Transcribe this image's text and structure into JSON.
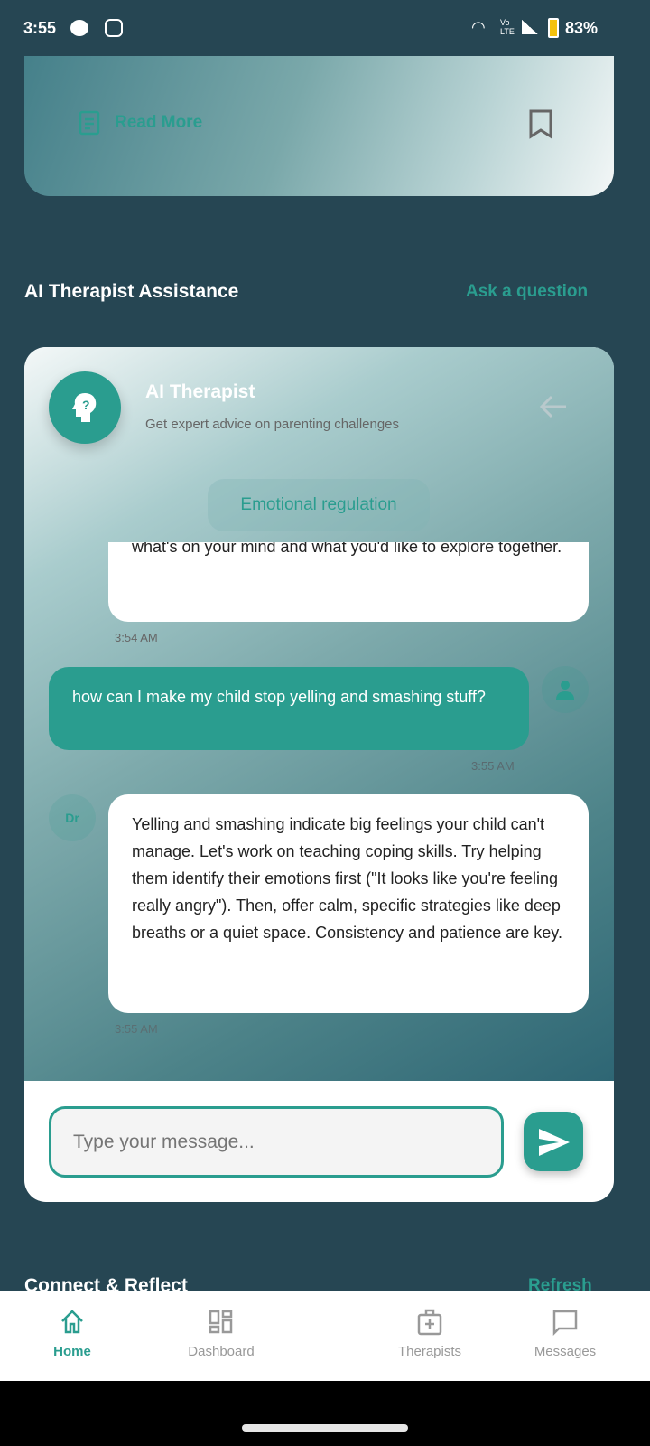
{
  "status_bar": {
    "time": "3:55",
    "battery": "83%"
  },
  "top_card": {
    "read_more": "Read More"
  },
  "ai_section": {
    "title": "AI Therapist Assistance",
    "action": "Ask a question"
  },
  "chat": {
    "title": "AI Therapist",
    "subtitle": "Get expert advice on parenting challenges",
    "topic": "Emotional regulation",
    "messages": [
      {
        "sender": "bot",
        "text": "what's on your mind and what you'd like to explore together.",
        "time": "3:54 AM"
      },
      {
        "sender": "user",
        "text": "how can I make my child stop yelling and smashing stuff?",
        "time": "3:55 AM"
      },
      {
        "sender": "bot",
        "avatar": "Dr",
        "text": "Yelling and smashing indicate big feelings your child can't manage. Let's work on teaching coping skills.  Try helping them identify their emotions first (\"It looks like you're feeling really angry\"). Then, offer calm, specific strategies like deep breaths or a quiet space.  Consistency and patience are key.",
        "time": "3:55 AM"
      }
    ],
    "input_placeholder": "Type your message..."
  },
  "connect_section": {
    "title": "Connect & Reflect",
    "action": "Refresh"
  },
  "nav": [
    {
      "label": "Home",
      "active": true
    },
    {
      "label": "Dashboard"
    },
    {
      "label": "Therapists"
    },
    {
      "label": "Messages"
    }
  ],
  "colors": {
    "accent": "#2a9d8f",
    "background": "#264653"
  }
}
